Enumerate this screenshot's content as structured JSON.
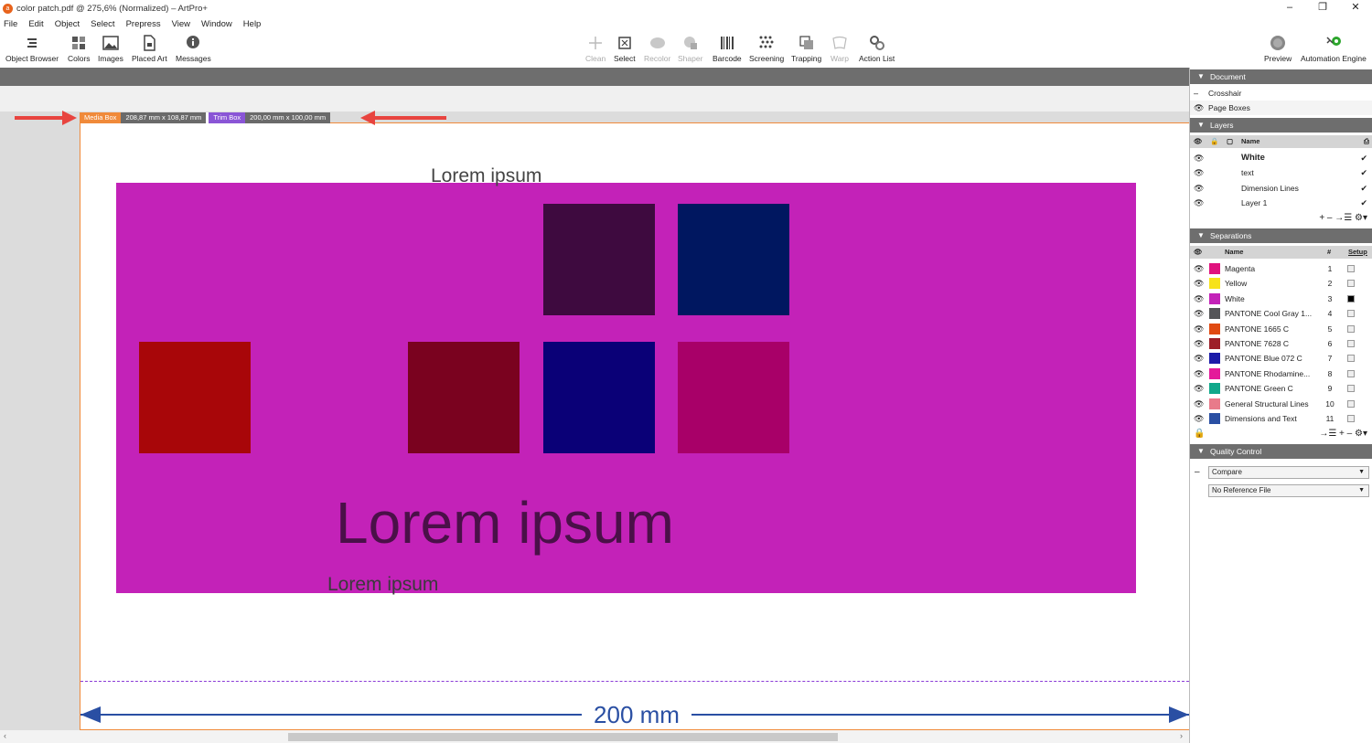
{
  "window": {
    "title": "color patch.pdf @ 275,6% (Normalized) – ArtPro+",
    "app_icon": "artpro-icon",
    "min": "–",
    "max": "❐",
    "close": "✕"
  },
  "menu": [
    "File",
    "Edit",
    "Object",
    "Select",
    "Prepress",
    "View",
    "Window",
    "Help"
  ],
  "toolbar_left": [
    {
      "label": "Object Browser",
      "icon": "object-browser-icon"
    },
    {
      "label": "Colors",
      "icon": "colors-icon"
    },
    {
      "label": "Images",
      "icon": "images-icon"
    },
    {
      "label": "Placed Art",
      "icon": "placed-art-icon"
    },
    {
      "label": "Messages",
      "icon": "messages-icon"
    }
  ],
  "toolbar_mid": [
    {
      "label": "Clean",
      "disabled": true
    },
    {
      "label": "Select",
      "disabled": false
    },
    {
      "label": "Recolor",
      "disabled": true
    },
    {
      "label": "Shaper",
      "disabled": true
    },
    {
      "label": "Barcode",
      "disabled": false
    },
    {
      "label": "Screening",
      "disabled": false
    },
    {
      "label": "Trapping",
      "disabled": false
    },
    {
      "label": "Warp",
      "disabled": true
    },
    {
      "label": "Action List",
      "disabled": false
    }
  ],
  "toolbar_right": [
    {
      "label": "Preview",
      "icon": "preview-icon"
    },
    {
      "label": "Automation Engine",
      "icon": "automation-engine-icon"
    }
  ],
  "boxes": {
    "media_label": "Media Box",
    "media_size": "208,87 mm x 108,87 mm",
    "trim_label": "Trim Box",
    "trim_size": "200,00 mm x 100,00 mm",
    "media_color": "#f08a3a",
    "trim_color": "#8a55d6"
  },
  "canvas": {
    "lorem_top": "Lorem ipsum",
    "lorem_big": "Lorem ipsum",
    "lorem_small": "Lorem ipsum",
    "dimension": "200 mm",
    "background_color": "#c322b8",
    "patch_colors": [
      "#3e0a3f",
      "#001760",
      "#a80609",
      "#7a021f",
      "#0a0077",
      "#a80068"
    ]
  },
  "panel": {
    "document": {
      "title": "Document",
      "items": [
        {
          "label": "Crosshair",
          "icon": "–"
        },
        {
          "label": "Page Boxes",
          "icon": "👁"
        }
      ]
    },
    "layers": {
      "title": "Layers",
      "col_name": "Name",
      "items": [
        {
          "name": "White",
          "bold": true
        },
        {
          "name": "text",
          "bold": false
        },
        {
          "name": "Dimension Lines",
          "bold": false
        },
        {
          "name": "Layer 1",
          "bold": false
        }
      ],
      "footer": "+  –  →☰  ⚙▾"
    },
    "separations": {
      "title": "Separations",
      "col_name": "Name",
      "col_num": "#",
      "col_setup": "Setup",
      "items": [
        {
          "name": "Magenta",
          "num": "1",
          "color": "#e0127e"
        },
        {
          "name": "Yellow",
          "num": "2",
          "color": "#f7e21a"
        },
        {
          "name": "White",
          "num": "3",
          "color": "#c322b8"
        },
        {
          "name": "PANTONE Cool Gray 1...",
          "num": "4",
          "color": "#555558"
        },
        {
          "name": "PANTONE 1665 C",
          "num": "5",
          "color": "#e04a12"
        },
        {
          "name": "PANTONE 7628 C",
          "num": "6",
          "color": "#9d1f28"
        },
        {
          "name": "PANTONE Blue 072 C",
          "num": "7",
          "color": "#1c1ba8"
        },
        {
          "name": "PANTONE Rhodamine...",
          "num": "8",
          "color": "#e41a9a"
        },
        {
          "name": "PANTONE Green C",
          "num": "9",
          "color": "#10a88a"
        },
        {
          "name": "General Structural Lines",
          "num": "10",
          "color": "#e87a8a"
        },
        {
          "name": "Dimensions and Text",
          "num": "11",
          "color": "#2a4fa3"
        }
      ],
      "footer": "→☰  +  –  ⚙▾"
    },
    "quality": {
      "title": "Quality Control",
      "compare": "Compare",
      "reference": "No Reference File"
    }
  }
}
